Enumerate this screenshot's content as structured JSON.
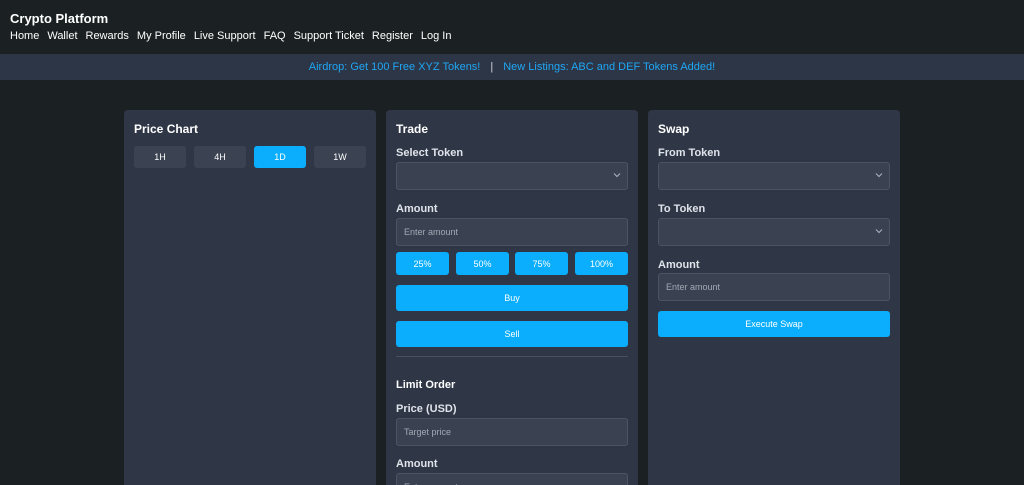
{
  "header": {
    "brand": "Crypto Platform",
    "nav": [
      "Home",
      "Wallet",
      "Rewards",
      "My Profile",
      "Live Support",
      "FAQ",
      "Support Ticket",
      "Register",
      "Log In"
    ]
  },
  "announcement": {
    "left": "Airdrop: Get 100 Free XYZ Tokens!",
    "separator": "|",
    "right": "New Listings: ABC and DEF Tokens Added!"
  },
  "price_chart": {
    "title": "Price Chart",
    "timeframes": [
      "1H",
      "4H",
      "1D",
      "1W"
    ],
    "active_timeframe": "1D"
  },
  "trade": {
    "title": "Trade",
    "select_token_label": "Select Token",
    "select_token_value": "",
    "amount_label": "Amount",
    "amount_placeholder": "Enter amount",
    "percentages": [
      "25%",
      "50%",
      "75%",
      "100%"
    ],
    "buy_label": "Buy",
    "sell_label": "Sell",
    "limit_order": {
      "title": "Limit Order",
      "price_label": "Price (USD)",
      "price_placeholder": "Target price",
      "amount_label": "Amount",
      "amount_placeholder": "Enter amount"
    }
  },
  "swap": {
    "title": "Swap",
    "from_label": "From Token",
    "from_value": "",
    "to_label": "To Token",
    "to_value": "",
    "amount_label": "Amount",
    "amount_placeholder": "Enter amount",
    "execute_label": "Execute Swap"
  },
  "colors": {
    "background": "#1b2123",
    "panel": "#2f3747",
    "accent": "#0aaefc",
    "link": "#1fa6f5"
  },
  "icons": {
    "select_arrow": "chevron-down-icon"
  }
}
